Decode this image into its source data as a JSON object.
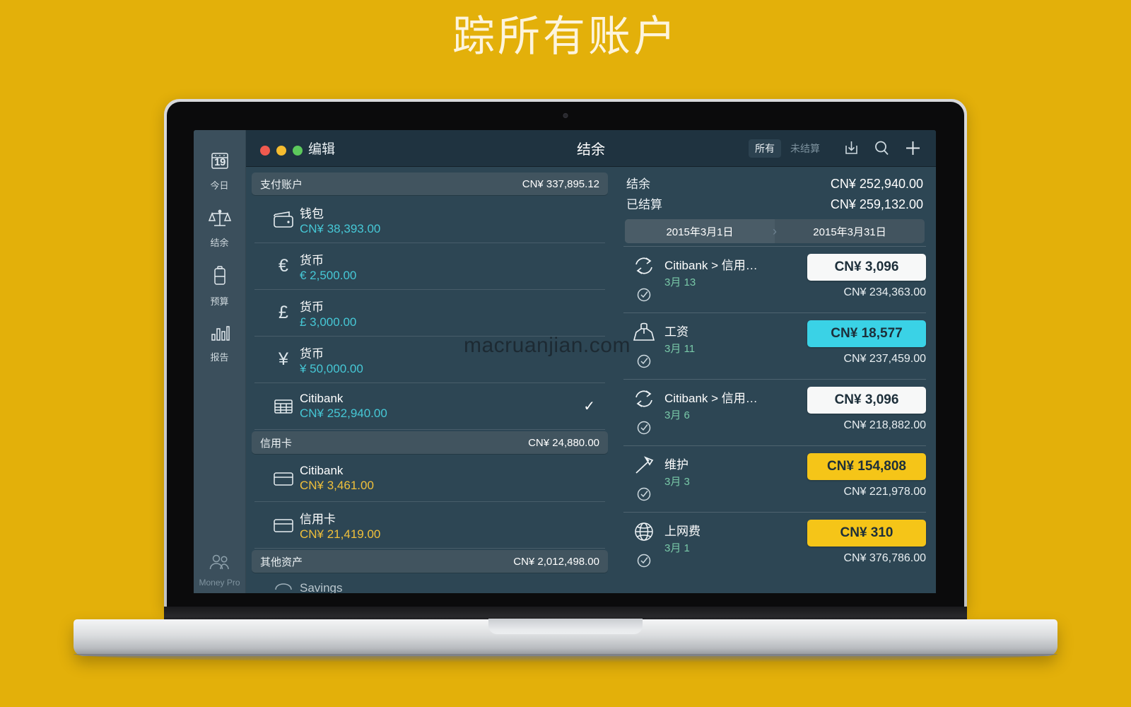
{
  "headline": "踪所有账户",
  "watermark": "macruanjian.com",
  "window": {
    "traffic_lights": [
      "close",
      "minimize",
      "zoom"
    ]
  },
  "sidebar": {
    "items": [
      {
        "label": "今日",
        "icon": "calendar-icon",
        "day": "19"
      },
      {
        "label": "结余",
        "icon": "scales-icon"
      },
      {
        "label": "预算",
        "icon": "battery-icon"
      },
      {
        "label": "报告",
        "icon": "bar-chart-icon"
      }
    ],
    "footer": {
      "label": "Money Pro",
      "icon": "people-icon"
    }
  },
  "toolbar": {
    "edit_label": "编辑",
    "title": "结余",
    "filters": [
      {
        "label": "所有",
        "selected": true
      },
      {
        "label": "未结算",
        "selected": false
      }
    ],
    "icons": [
      "import-icon",
      "search-icon",
      "add-icon"
    ]
  },
  "accounts": {
    "groups": [
      {
        "name": "支付账户",
        "total": "CN¥ 337,895.12",
        "items": [
          {
            "name": "钱包",
            "amount": "CN¥ 38,393.00",
            "icon": "wallet-icon",
            "color": "cyan",
            "checked": false
          },
          {
            "name": "货币",
            "amount": "€ 2,500.00",
            "icon": "euro-symbol",
            "color": "cyan",
            "checked": false
          },
          {
            "name": "货币",
            "amount": "£ 3,000.00",
            "icon": "pound-symbol",
            "color": "cyan",
            "checked": false
          },
          {
            "name": "货币",
            "amount": "¥ 50,000.00",
            "icon": "yen-symbol",
            "color": "cyan",
            "checked": false
          },
          {
            "name": "Citibank",
            "amount": "CN¥ 252,940.00",
            "icon": "bank-icon",
            "color": "cyan",
            "checked": true
          }
        ]
      },
      {
        "name": "信用卡",
        "total": "CN¥ 24,880.00",
        "items": [
          {
            "name": "Citibank",
            "amount": "CN¥ 3,461.00",
            "icon": "credit-card-icon",
            "color": "gold",
            "checked": false
          },
          {
            "name": "信用卡",
            "amount": "CN¥ 21,419.00",
            "icon": "credit-card-icon",
            "color": "gold",
            "checked": false
          }
        ]
      },
      {
        "name": "其他资产",
        "total": "CN¥ 2,012,498.00",
        "items": [
          {
            "name": "Savings",
            "amount": "",
            "icon": "savings-icon",
            "color": "cyan",
            "checked": false
          }
        ]
      }
    ]
  },
  "summary": {
    "balance_label": "结余",
    "balance_value": "CN¥ 252,940.00",
    "cleared_label": "已结算",
    "cleared_value": "CN¥ 259,132.00",
    "date_from": "2015年3月1日",
    "date_to": "2015年3月31日"
  },
  "transactions": [
    {
      "title": "Citibank > 信用…",
      "date": "3月 13",
      "amount": "CN¥ 3,096",
      "pill": "white",
      "balance": "CN¥ 234,363.00",
      "icon": "transfer-icon",
      "cleared": true
    },
    {
      "title": "工资",
      "date": "3月 11",
      "amount": "CN¥ 18,577",
      "pill": "cyan",
      "balance": "CN¥ 237,459.00",
      "icon": "salary-icon",
      "cleared": true
    },
    {
      "title": "Citibank > 信用…",
      "date": "3月 6",
      "amount": "CN¥ 3,096",
      "pill": "white",
      "balance": "CN¥ 218,882.00",
      "icon": "transfer-icon",
      "cleared": true
    },
    {
      "title": "维护",
      "date": "3月 3",
      "amount": "CN¥ 154,808",
      "pill": "gold",
      "balance": "CN¥ 221,978.00",
      "icon": "hammer-icon",
      "cleared": true
    },
    {
      "title": "上网费",
      "date": "3月 1",
      "amount": "CN¥ 310",
      "pill": "gold",
      "balance": "CN¥ 376,786.00",
      "icon": "globe-icon",
      "cleared": true
    }
  ],
  "colors": {
    "brand_yellow": "#e3b00a",
    "app_bg": "#2d4654",
    "toolbar_bg": "#1f3340",
    "sidebar_bg": "#3b4f5c",
    "cyan": "#46c8d6",
    "gold": "#f0c03a",
    "date_green": "#79c9a8"
  }
}
